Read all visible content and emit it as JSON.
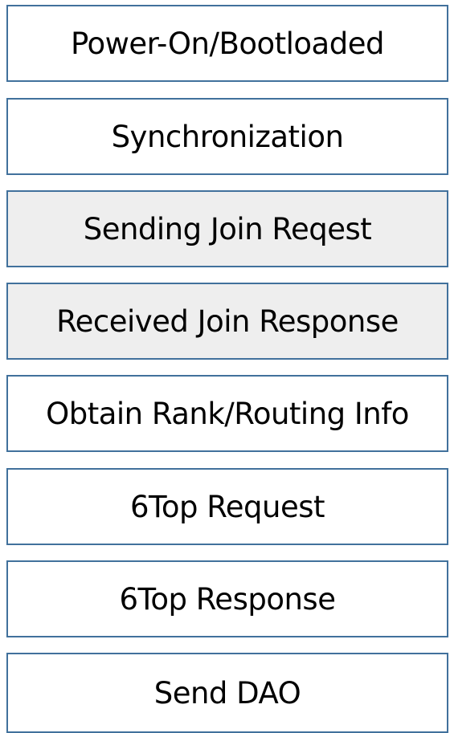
{
  "steps": [
    {
      "label": "Power-On/Bootloaded"
    },
    {
      "label": "Synchronization"
    },
    {
      "label": "Sending Join Reqest"
    },
    {
      "label": "Received Join Response"
    },
    {
      "label": "Obtain Rank/Routing Info"
    },
    {
      "label": "6Top Request"
    },
    {
      "label": "6Top Response"
    },
    {
      "label": "Send DAO"
    }
  ],
  "colors": {
    "border": "#41719C",
    "highlight_fill": "#EEEEEE",
    "default_fill": "#FFFFFF"
  }
}
